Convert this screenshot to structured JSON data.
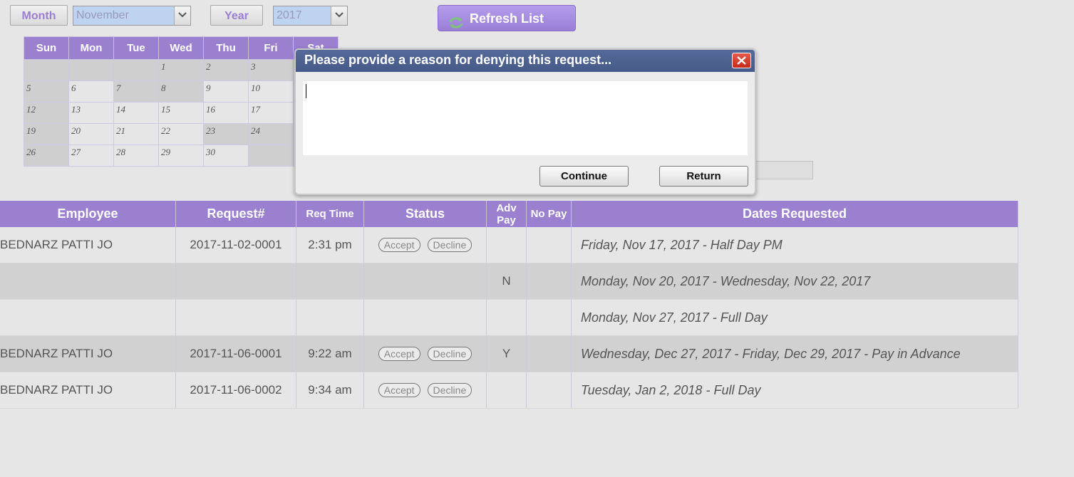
{
  "filters": {
    "month_label": "Month",
    "month_value": "November",
    "year_label": "Year",
    "year_value": "2017",
    "refresh_label": "Refresh List"
  },
  "calendar": {
    "weekdays": [
      "Sun",
      "Mon",
      "Tue",
      "Wed",
      "Thu",
      "Fri",
      "Sat"
    ],
    "rows": [
      [
        "",
        "",
        "",
        "1",
        "2",
        "3",
        ""
      ],
      [
        "5",
        "6",
        "7",
        "8",
        "9",
        "10",
        ""
      ],
      [
        "12",
        "13",
        "14",
        "15",
        "16",
        "17",
        ""
      ],
      [
        "19",
        "20",
        "21",
        "22",
        "23",
        "24",
        ""
      ],
      [
        "26",
        "27",
        "28",
        "29",
        "30",
        "",
        ""
      ]
    ]
  },
  "dialog": {
    "title": "Please provide a reason for denying this request...",
    "reason_value": "",
    "continue_label": "Continue",
    "return_label": "Return"
  },
  "table": {
    "headers": {
      "employee": "Employee",
      "request": "Request#",
      "req_time": "Req Time",
      "status": "Status",
      "adv_pay": "Adv Pay",
      "no_pay": "No Pay",
      "dates": "Dates Requested"
    },
    "accept_label": "Accept",
    "decline_label": "Decline",
    "rows": [
      {
        "employee": "BEDNARZ PATTI JO",
        "request": "2017-11-02-0001",
        "time": "2:31 pm",
        "adv": "",
        "nopay": "",
        "dates": "Friday, Nov 17, 2017 - Half Day PM"
      },
      {
        "employee": "",
        "request": "",
        "time": "",
        "adv": "N",
        "nopay": "",
        "dates": "Monday, Nov 20, 2017 - Wednesday, Nov 22, 2017"
      },
      {
        "employee": "",
        "request": "",
        "time": "",
        "adv": "",
        "nopay": "",
        "dates": "Monday, Nov 27, 2017 - Full Day"
      },
      {
        "employee": "BEDNARZ PATTI JO",
        "request": "2017-11-06-0001",
        "time": "9:22 am",
        "adv": "Y",
        "nopay": "",
        "dates": "Wednesday, Dec 27, 2017 - Friday, Dec 29, 2017 - Pay in Advance"
      },
      {
        "employee": "BEDNARZ PATTI JO",
        "request": "2017-11-06-0002",
        "time": "9:34 am",
        "adv": "",
        "nopay": "",
        "dates": "Tuesday, Jan 2, 2018 - Full Day"
      }
    ]
  },
  "colors": {
    "accent": "#9b80d0",
    "dialog_title": "#4e6290",
    "close": "#d6402f"
  }
}
